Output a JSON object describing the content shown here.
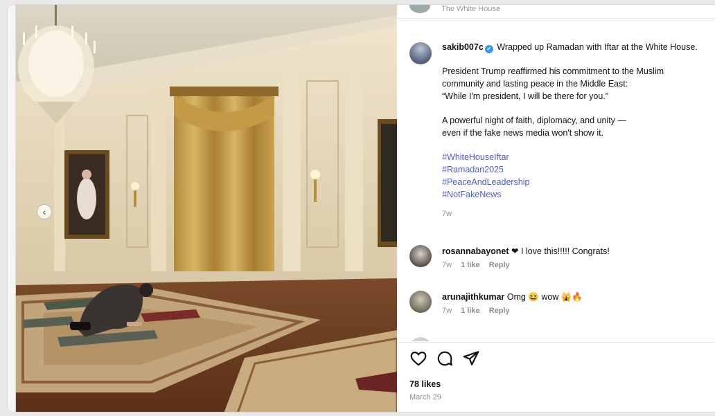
{
  "post": {
    "top_user_faint": "The White House",
    "caption": {
      "username": "sakib007c",
      "verified": "✔",
      "text_1": " Wrapped up Ramadan with Iftar at the White House.",
      "para_2_line1": "President Trump reaffirmed his commitment to the Muslim",
      "para_2_line2": "community and lasting peace in the Middle East:",
      "para_2_line3": "“While I'm president, I will be there for you.”",
      "para_3_line1": "A powerful night of faith, diplomacy, and unity —",
      "para_3_line2": "even if the fake news media won't show it.",
      "hashtags": [
        "#WhiteHouseIftar",
        "#Ramadan2025",
        "#PeaceAndLeadership",
        "#NotFakeNews"
      ],
      "time": "7w"
    },
    "comments": [
      {
        "username": "rosannabayonet",
        "text": " ❤ I love this!!!!! Congrats!",
        "time": "7w",
        "likes": "1 like",
        "reply": "Reply"
      },
      {
        "username": "arunajithkumar",
        "text": " Omg 😆 wow 🙀🔥",
        "time": "7w",
        "likes": "1 like",
        "reply": "Reply"
      }
    ],
    "likes_count": "78 likes",
    "date": "March 29"
  },
  "icons": {
    "like": "heart-icon",
    "comment": "comment-icon",
    "share": "send-icon",
    "save": "bookmark-icon",
    "carousel_prev": "chevron-left-icon"
  },
  "colors": {
    "hashtag": "#4a5fd0",
    "verified": "#3897f0",
    "meta": "#8e8e8e"
  }
}
